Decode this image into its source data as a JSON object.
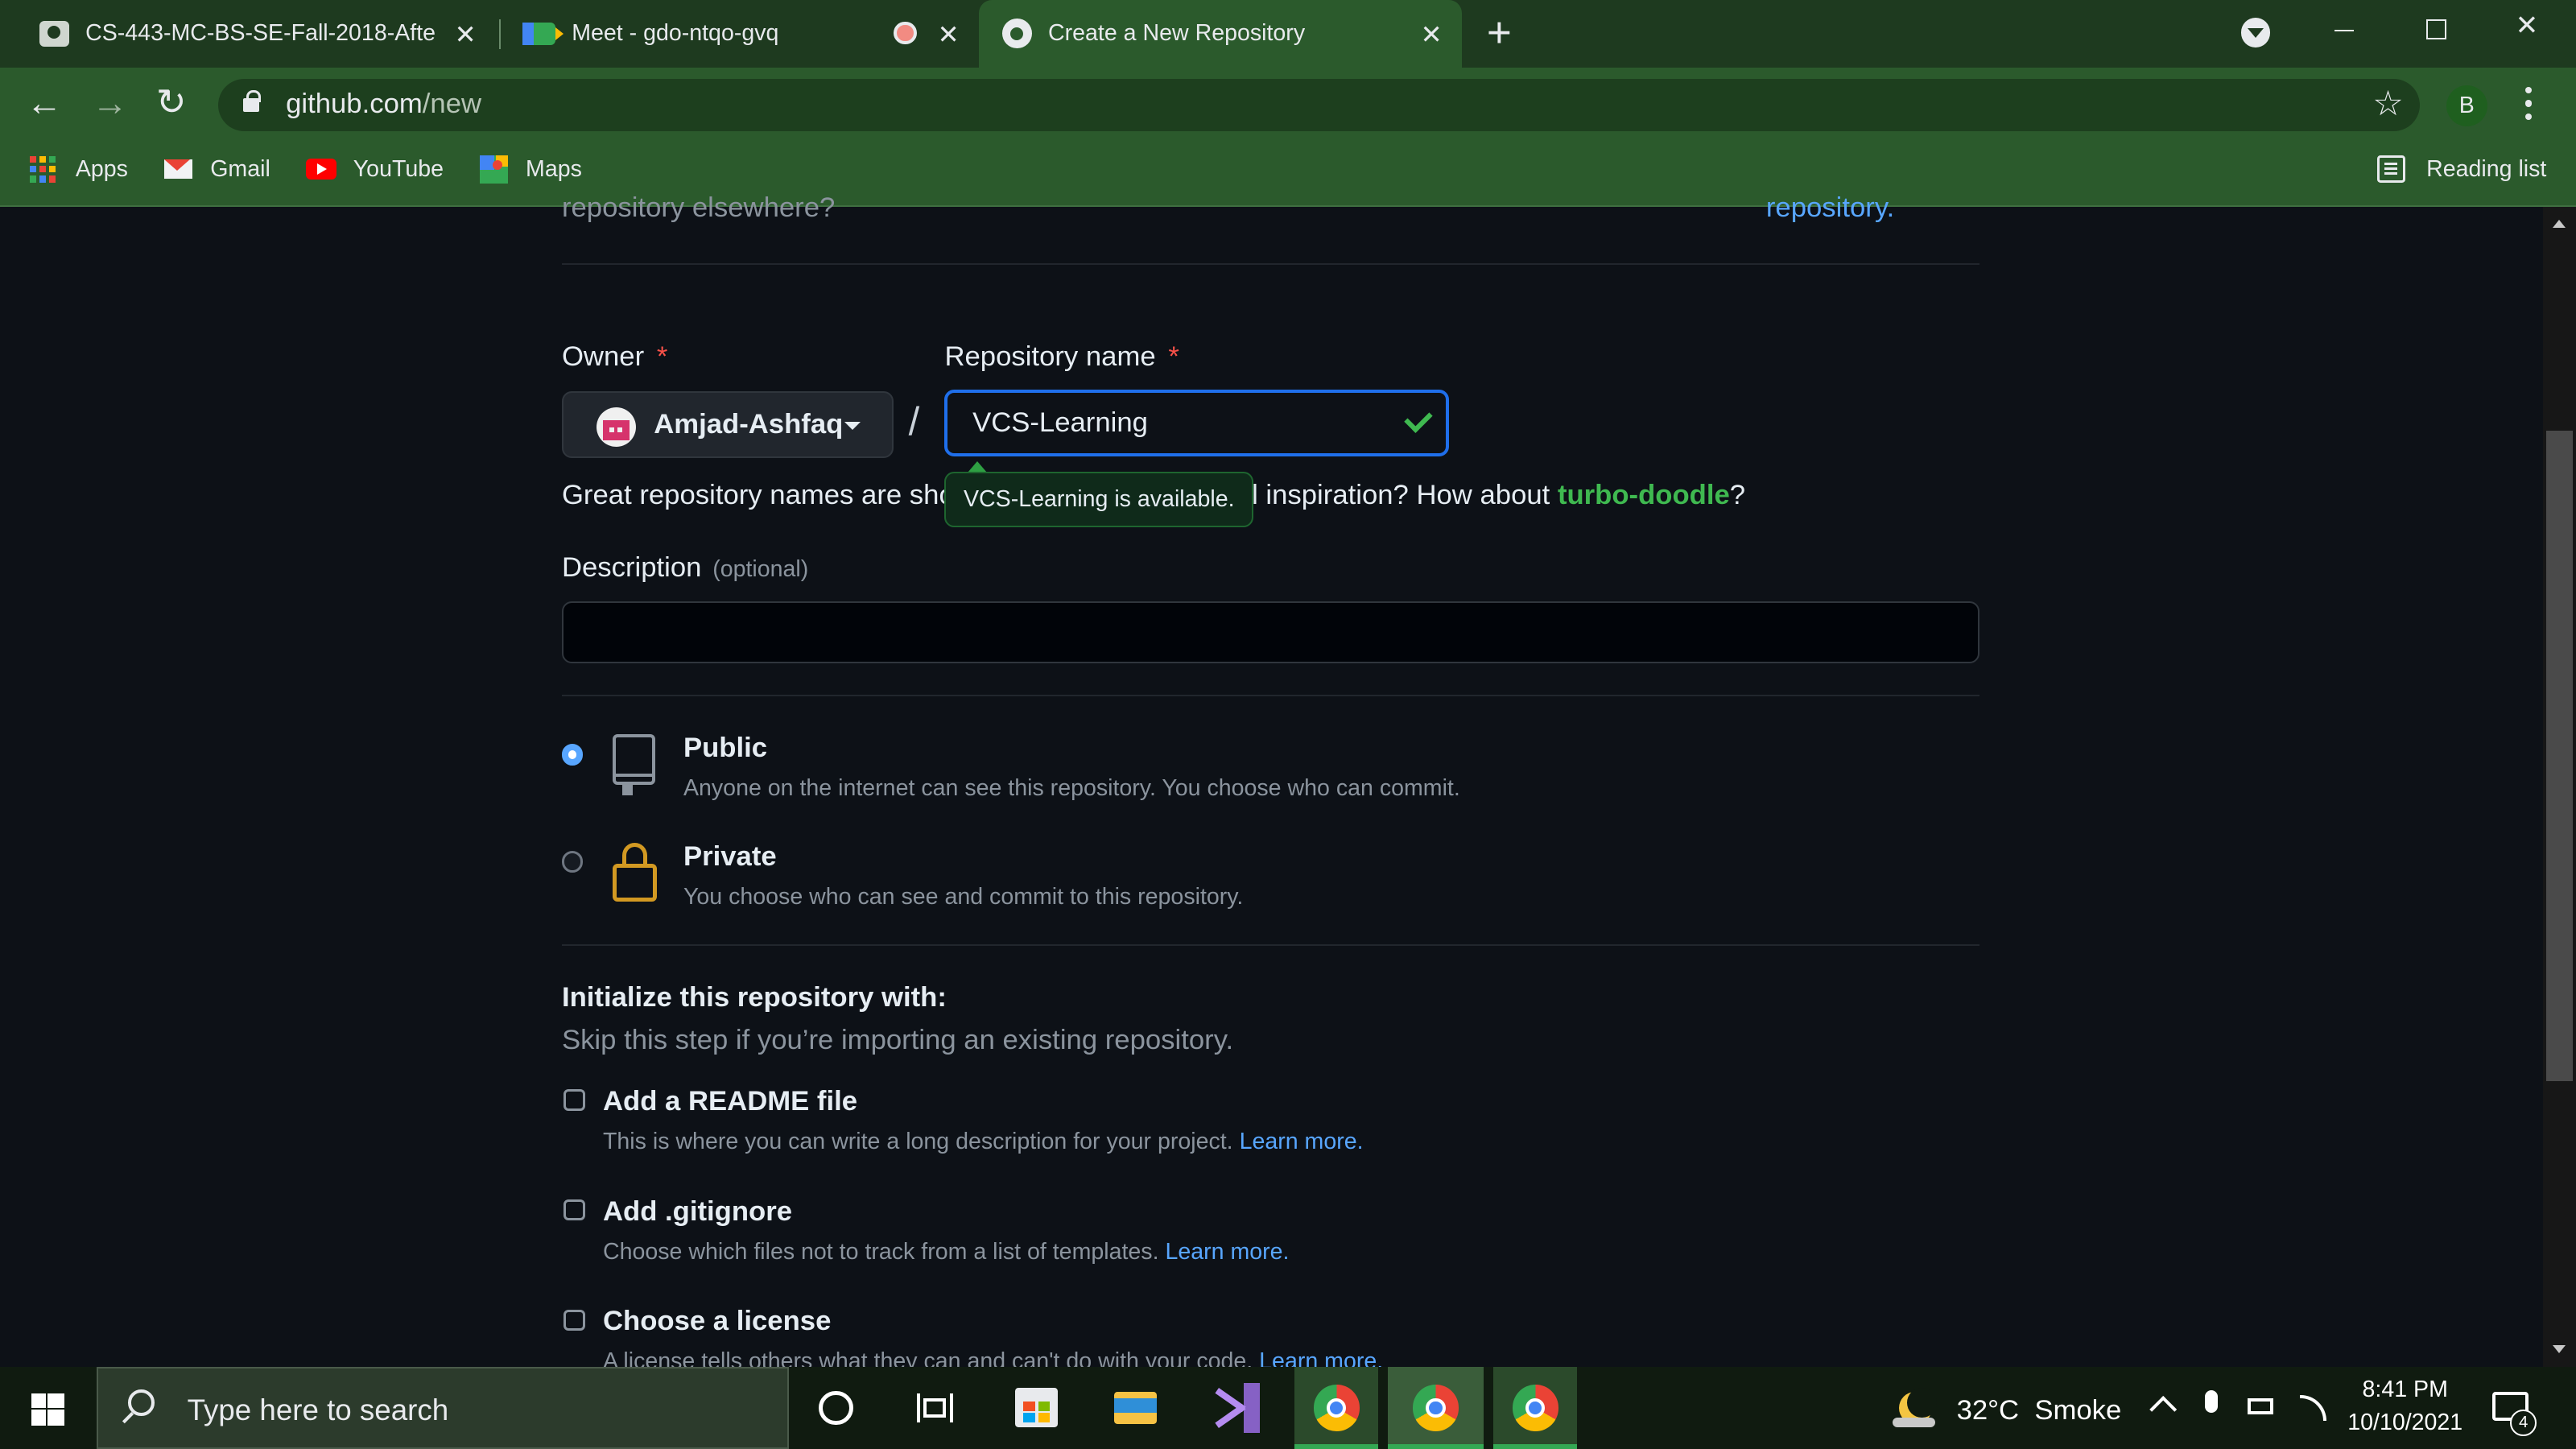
{
  "browser": {
    "tabs": [
      {
        "title": "CS-443-MC-BS-SE-Fall-2018-Afte"
      },
      {
        "title": "Meet - gdo-ntqo-gvq"
      },
      {
        "title": "Create a New Repository"
      }
    ],
    "address": {
      "host": "github.com",
      "path": "/new"
    },
    "profile_initial": "B",
    "bookmarks": [
      {
        "label": "Apps"
      },
      {
        "label": "Gmail"
      },
      {
        "label": "YouTube"
      },
      {
        "label": "Maps"
      }
    ],
    "reading_list": "Reading list"
  },
  "page": {
    "top_text_left": "repository elsewhere?",
    "top_text_right": "repository.",
    "owner_label": "Owner",
    "required_mark": "*",
    "owner_value": "Amjad-Ashfaq",
    "slash": "/",
    "repo_label": "Repository name",
    "repo_value": "VCS-Learning",
    "availability_tooltip": "VCS-Learning is available.",
    "hint_prefix": "Great repository names are sho",
    "hint_suffix": "l inspiration? How about ",
    "suggestion": "turbo-doodle",
    "hint_end": "?",
    "description_label": "Description",
    "description_optional": "(optional)",
    "description_value": "",
    "visibility": [
      {
        "title": "Public",
        "desc": "Anyone on the internet can see this repository. You choose who can commit.",
        "selected": true
      },
      {
        "title": "Private",
        "desc": "You choose who can see and commit to this repository.",
        "selected": false
      }
    ],
    "init_title": "Initialize this repository with:",
    "init_subtitle": "Skip this step if you’re importing an existing repository.",
    "init_options": [
      {
        "title": "Add a README file",
        "desc": "This is where you can write a long description for your project.",
        "link": "Learn more.",
        "checked": false
      },
      {
        "title": "Add .gitignore",
        "desc": "Choose which files not to track from a list of templates.",
        "link": "Learn more.",
        "checked": false
      },
      {
        "title": "Choose a license",
        "desc": "A license tells others what they can and can't do with your code.",
        "link": "Learn more.",
        "checked": false
      }
    ]
  },
  "taskbar": {
    "search_placeholder": "Type here to search",
    "weather": "32°C  Smoke",
    "time": "8:41 PM",
    "date": "10/10/2021",
    "notifications": "4"
  },
  "colors": {
    "chrome_tabbar": "#1e3a1f",
    "chrome_toolbar": "#2b5a2c",
    "page_bg": "#0d1117",
    "link": "#58a6ff",
    "success": "#3fb950",
    "focus": "#1f6feb",
    "private_lock": "#d29922"
  }
}
